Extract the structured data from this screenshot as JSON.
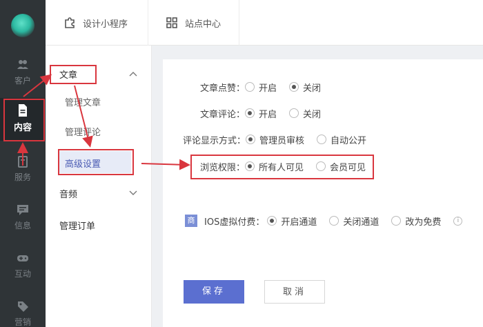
{
  "rail": {
    "items": [
      {
        "label": "客户",
        "icon": "customer-icon"
      },
      {
        "label": "内容",
        "icon": "document-icon"
      },
      {
        "label": "服务",
        "icon": "service-icon"
      },
      {
        "label": "信息",
        "icon": "message-icon"
      },
      {
        "label": "互动",
        "icon": "gamepad-icon"
      },
      {
        "label": "营销",
        "icon": "tag-icon"
      }
    ]
  },
  "topbar": {
    "nav1": "设计小程序",
    "nav2": "站点中心"
  },
  "sidebar": {
    "group1": "文章",
    "item_manage_article": "管理文章",
    "item_manage_comment": "管理评论",
    "item_advanced": "高级设置",
    "group2": "音频",
    "item_orders": "管理订单"
  },
  "form": {
    "like_label": "文章点赞：",
    "like_opt_on": "开启",
    "like_opt_off": "关闭",
    "like_selected": "关闭",
    "comment_label": "文章评论：",
    "comment_opt_on": "开启",
    "comment_opt_off": "关闭",
    "comment_selected": "开启",
    "display_label": "评论显示方式：",
    "display_opt_review": "管理员审核",
    "display_opt_public": "自动公开",
    "display_selected": "管理员审核",
    "perm_label": "浏览权限：",
    "perm_opt_all": "所有人可见",
    "perm_opt_member": "会员可见",
    "perm_selected": "所有人可见",
    "ios_badge": "商",
    "ios_label": "IOS虚拟付费：",
    "ios_opt_open": "开启通道",
    "ios_opt_close": "关闭通道",
    "ios_opt_free": "改为免费",
    "ios_selected": "开启通道",
    "info_glyph": "i"
  },
  "buttons": {
    "save": "保存",
    "cancel": "取消"
  },
  "colors": {
    "rail_bg": "#2f3437",
    "accent": "#5b6fd0",
    "annotation_red": "#d9363e"
  }
}
